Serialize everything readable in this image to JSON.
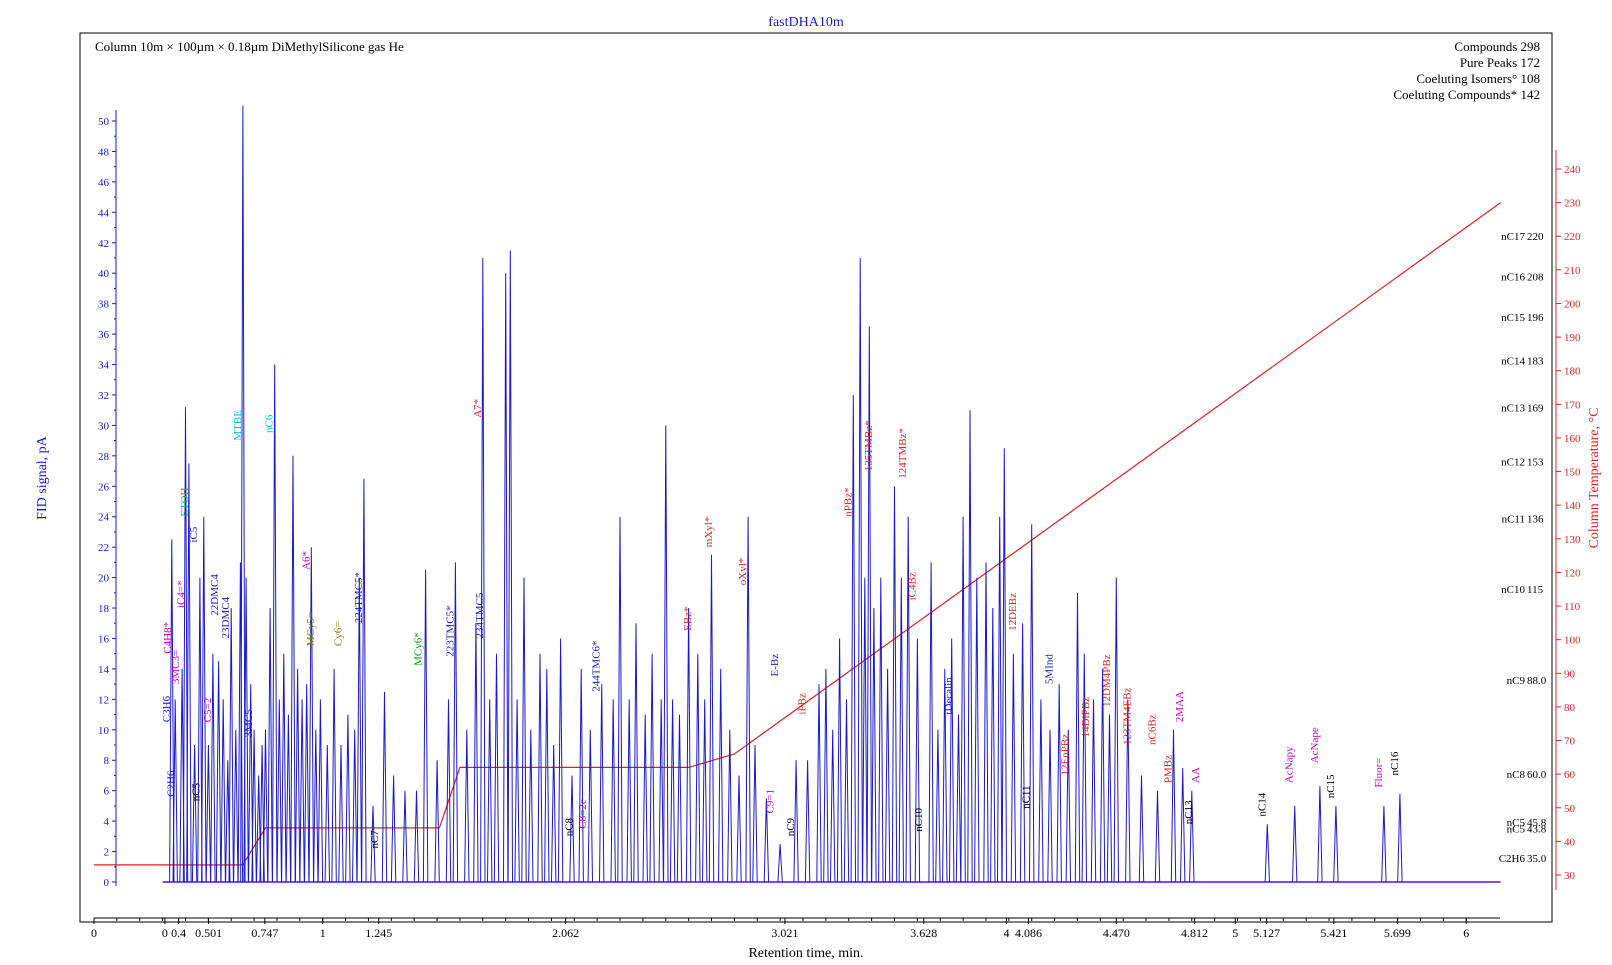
{
  "chart_data": {
    "type": "line",
    "title": "fastDHA10m",
    "subtitle": "Column 10m × 100µm × 0.18µm DiMethylSilicone gas He",
    "stats": [
      "Compounds 298",
      "Pure Peaks 172",
      "Coeluting Isomers° 108",
      "Coeluting Compounds* 142"
    ],
    "xlabel": "Retention time, min.",
    "ylabel": "FID signal, pA",
    "y2label": "Column Temperature, °C",
    "xlim": [
      0,
      6.2
    ],
    "ylim": [
      -1,
      52
    ],
    "y2lim": [
      23.5,
      246
    ],
    "x_ticks": [
      {
        "v": 0,
        "label": "0"
      },
      {
        "v": 0.31,
        "label": "0"
      },
      {
        "v": 0.37,
        "label": "0.4"
      },
      {
        "v": 0.501,
        "label": "0.501"
      },
      {
        "v": 0.747,
        "label": "0.747"
      },
      {
        "v": 1,
        "label": "1"
      },
      {
        "v": 1.245,
        "label": "1.245"
      },
      {
        "v": 2.062,
        "label": "2.062"
      },
      {
        "v": 3.021,
        "label": "3.021"
      },
      {
        "v": 3.628,
        "label": "3.628"
      },
      {
        "v": 3.99,
        "label": "4"
      },
      {
        "v": 4.086,
        "label": "4.086"
      },
      {
        "v": 4.47,
        "label": "4.470"
      },
      {
        "v": 4.812,
        "label": "4.812"
      },
      {
        "v": 4.99,
        "label": "5"
      },
      {
        "v": 5.127,
        "label": "5.127"
      },
      {
        "v": 5.421,
        "label": "5.421"
      },
      {
        "v": 5.699,
        "label": "5.699"
      },
      {
        "v": 6,
        "label": "6"
      }
    ],
    "y_ticks": [
      0,
      2,
      4,
      6,
      8,
      10,
      12,
      14,
      16,
      18,
      20,
      22,
      24,
      26,
      28,
      30,
      32,
      34,
      36,
      38,
      40,
      42,
      44,
      46,
      48,
      50
    ],
    "y2_ticks": [
      30,
      40,
      50,
      60,
      70,
      80,
      90,
      100,
      110,
      120,
      130,
      140,
      150,
      160,
      170,
      180,
      190,
      200,
      210,
      220,
      230,
      240
    ],
    "n_paraffin_markers": [
      {
        "label": "nC17",
        "value": "220",
        "t": 220
      },
      {
        "label": "nC16",
        "value": "208",
        "t": 208
      },
      {
        "label": "nC15",
        "value": "196",
        "t": 196
      },
      {
        "label": "nC14",
        "value": "183",
        "t": 183
      },
      {
        "label": "nC13",
        "value": "169",
        "t": 169
      },
      {
        "label": "nC12",
        "value": "153",
        "t": 153
      },
      {
        "label": "nC11",
        "value": "136",
        "t": 136
      },
      {
        "label": "nC10",
        "value": "115",
        "t": 115
      },
      {
        "label": "nC9",
        "value": "88.0",
        "t": 88
      },
      {
        "label": "nC8",
        "value": "60.0",
        "t": 60
      },
      {
        "label": "nC5",
        "value": "45.8",
        "t": 45.8
      },
      {
        "label": "nC5",
        "value": "43.8",
        "t": 43.8
      },
      {
        "label": "C2H6",
        "value": "35.0",
        "t": 35
      }
    ],
    "temperature_program": [
      [
        0,
        33
      ],
      [
        0.65,
        33
      ],
      [
        0.75,
        44
      ],
      [
        1.51,
        44
      ],
      [
        1.6,
        62
      ],
      [
        2.6,
        62
      ],
      [
        2.8,
        66
      ],
      [
        6.15,
        230
      ]
    ],
    "peaks": [
      {
        "x": 0.34,
        "h": 22.5
      },
      {
        "x": 0.355,
        "h": 12
      },
      {
        "x": 0.385,
        "h": 14
      },
      {
        "x": 0.4,
        "h": 31.2
      },
      {
        "x": 0.415,
        "h": 27.5
      },
      {
        "x": 0.44,
        "h": 9
      },
      {
        "x": 0.463,
        "h": 20
      },
      {
        "x": 0.48,
        "h": 24
      },
      {
        "x": 0.5,
        "h": 9
      },
      {
        "x": 0.52,
        "h": 15
      },
      {
        "x": 0.545,
        "h": 14.5
      },
      {
        "x": 0.565,
        "h": 12
      },
      {
        "x": 0.585,
        "h": 8
      },
      {
        "x": 0.6,
        "h": 18
      },
      {
        "x": 0.62,
        "h": 10
      },
      {
        "x": 0.64,
        "h": 21
      },
      {
        "x": 0.651,
        "h": 51
      },
      {
        "x": 0.665,
        "h": 20
      },
      {
        "x": 0.685,
        "h": 13
      },
      {
        "x": 0.7,
        "h": 10
      },
      {
        "x": 0.72,
        "h": 7
      },
      {
        "x": 0.735,
        "h": 9
      },
      {
        "x": 0.75,
        "h": 10
      },
      {
        "x": 0.77,
        "h": 18
      },
      {
        "x": 0.79,
        "h": 34
      },
      {
        "x": 0.81,
        "h": 12
      },
      {
        "x": 0.83,
        "h": 15
      },
      {
        "x": 0.85,
        "h": 11
      },
      {
        "x": 0.87,
        "h": 28
      },
      {
        "x": 0.89,
        "h": 14
      },
      {
        "x": 0.91,
        "h": 12
      },
      {
        "x": 0.93,
        "h": 13
      },
      {
        "x": 0.95,
        "h": 22
      },
      {
        "x": 0.97,
        "h": 10
      },
      {
        "x": 0.99,
        "h": 12
      },
      {
        "x": 1.02,
        "h": 9
      },
      {
        "x": 1.05,
        "h": 14
      },
      {
        "x": 1.08,
        "h": 9
      },
      {
        "x": 1.11,
        "h": 11
      },
      {
        "x": 1.14,
        "h": 10
      },
      {
        "x": 1.16,
        "h": 20
      },
      {
        "x": 1.18,
        "h": 26.5
      },
      {
        "x": 1.22,
        "h": 5
      },
      {
        "x": 1.27,
        "h": 12.5
      },
      {
        "x": 1.31,
        "h": 7
      },
      {
        "x": 1.36,
        "h": 6
      },
      {
        "x": 1.41,
        "h": 6
      },
      {
        "x": 1.45,
        "h": 20.5
      },
      {
        "x": 1.5,
        "h": 8
      },
      {
        "x": 1.55,
        "h": 12
      },
      {
        "x": 1.58,
        "h": 21
      },
      {
        "x": 1.63,
        "h": 10
      },
      {
        "x": 1.67,
        "h": 17
      },
      {
        "x": 1.7,
        "h": 41
      },
      {
        "x": 1.73,
        "h": 12
      },
      {
        "x": 1.76,
        "h": 15
      },
      {
        "x": 1.8,
        "h": 40
      },
      {
        "x": 1.82,
        "h": 41.5
      },
      {
        "x": 1.85,
        "h": 12
      },
      {
        "x": 1.88,
        "h": 20
      },
      {
        "x": 1.91,
        "h": 10
      },
      {
        "x": 1.95,
        "h": 15
      },
      {
        "x": 1.98,
        "h": 14
      },
      {
        "x": 2.01,
        "h": 9
      },
      {
        "x": 2.04,
        "h": 16
      },
      {
        "x": 2.09,
        "h": 7
      },
      {
        "x": 2.13,
        "h": 14
      },
      {
        "x": 2.17,
        "h": 10
      },
      {
        "x": 2.22,
        "h": 13
      },
      {
        "x": 2.27,
        "h": 12
      },
      {
        "x": 2.3,
        "h": 24
      },
      {
        "x": 2.34,
        "h": 12
      },
      {
        "x": 2.37,
        "h": 17
      },
      {
        "x": 2.41,
        "h": 11
      },
      {
        "x": 2.44,
        "h": 15
      },
      {
        "x": 2.48,
        "h": 12
      },
      {
        "x": 2.5,
        "h": 30
      },
      {
        "x": 2.53,
        "h": 12
      },
      {
        "x": 2.56,
        "h": 11
      },
      {
        "x": 2.6,
        "h": 18
      },
      {
        "x": 2.64,
        "h": 15
      },
      {
        "x": 2.67,
        "h": 12
      },
      {
        "x": 2.7,
        "h": 21.5
      },
      {
        "x": 2.74,
        "h": 14
      },
      {
        "x": 2.78,
        "h": 10
      },
      {
        "x": 2.82,
        "h": 7
      },
      {
        "x": 2.86,
        "h": 24
      },
      {
        "x": 2.89,
        "h": 9
      },
      {
        "x": 2.94,
        "h": 5.5
      },
      {
        "x": 3.0,
        "h": 2.5
      },
      {
        "x": 3.07,
        "h": 8
      },
      {
        "x": 3.12,
        "h": 8
      },
      {
        "x": 3.17,
        "h": 13
      },
      {
        "x": 3.2,
        "h": 14
      },
      {
        "x": 3.23,
        "h": 10
      },
      {
        "x": 3.26,
        "h": 16
      },
      {
        "x": 3.29,
        "h": 12
      },
      {
        "x": 3.32,
        "h": 32
      },
      {
        "x": 3.35,
        "h": 41
      },
      {
        "x": 3.37,
        "h": 20
      },
      {
        "x": 3.39,
        "h": 36.5
      },
      {
        "x": 3.41,
        "h": 18
      },
      {
        "x": 3.44,
        "h": 20
      },
      {
        "x": 3.47,
        "h": 14
      },
      {
        "x": 3.5,
        "h": 26
      },
      {
        "x": 3.53,
        "h": 20
      },
      {
        "x": 3.56,
        "h": 24
      },
      {
        "x": 3.6,
        "h": 16
      },
      {
        "x": 3.66,
        "h": 21
      },
      {
        "x": 3.69,
        "h": 10
      },
      {
        "x": 3.72,
        "h": 14
      },
      {
        "x": 3.75,
        "h": 16
      },
      {
        "x": 3.78,
        "h": 11
      },
      {
        "x": 3.8,
        "h": 24
      },
      {
        "x": 3.83,
        "h": 31
      },
      {
        "x": 3.86,
        "h": 20
      },
      {
        "x": 3.9,
        "h": 21
      },
      {
        "x": 3.93,
        "h": 18
      },
      {
        "x": 3.96,
        "h": 24
      },
      {
        "x": 3.98,
        "h": 28.5
      },
      {
        "x": 4.02,
        "h": 15
      },
      {
        "x": 4.06,
        "h": 17
      },
      {
        "x": 4.1,
        "h": 23.5
      },
      {
        "x": 4.14,
        "h": 12
      },
      {
        "x": 4.18,
        "h": 10
      },
      {
        "x": 4.22,
        "h": 13
      },
      {
        "x": 4.26,
        "h": 10
      },
      {
        "x": 4.3,
        "h": 19
      },
      {
        "x": 4.33,
        "h": 15
      },
      {
        "x": 4.37,
        "h": 12
      },
      {
        "x": 4.41,
        "h": 14
      },
      {
        "x": 4.44,
        "h": 11
      },
      {
        "x": 4.47,
        "h": 20
      },
      {
        "x": 4.52,
        "h": 12
      },
      {
        "x": 4.58,
        "h": 7
      },
      {
        "x": 4.65,
        "h": 6
      },
      {
        "x": 4.72,
        "h": 10
      },
      {
        "x": 4.76,
        "h": 7.5
      },
      {
        "x": 4.8,
        "h": 6
      },
      {
        "x": 5.13,
        "h": 3.8
      },
      {
        "x": 5.25,
        "h": 5
      },
      {
        "x": 5.36,
        "h": 6.3
      },
      {
        "x": 5.43,
        "h": 5
      },
      {
        "x": 5.64,
        "h": 5
      },
      {
        "x": 5.71,
        "h": 5.8
      }
    ],
    "peak_labels": [
      {
        "x": 0.34,
        "y": 10.5,
        "text": "C3H6",
        "color": "#1a1acc"
      },
      {
        "x": 0.36,
        "y": 5.6,
        "text": "C2H6",
        "color": "#1a1acc"
      },
      {
        "x": 0.345,
        "y": 15,
        "text": "C4H8*",
        "color": "#c000c0"
      },
      {
        "x": 0.38,
        "y": 13,
        "text": "3MC3=",
        "color": "#c000c0"
      },
      {
        "x": 0.405,
        "y": 18,
        "text": "iC4=*",
        "color": "#c000c0"
      },
      {
        "x": 0.42,
        "y": 24,
        "text": "ETOH",
        "color": "#00c050"
      },
      {
        "x": 0.46,
        "y": 22.3,
        "text": "iC5",
        "color": "#1a1acc"
      },
      {
        "x": 0.47,
        "y": 5.3,
        "text": "nC5",
        "color": "#000000"
      },
      {
        "x": 0.52,
        "y": 10.5,
        "text": "C5=2",
        "color": "#c000c0"
      },
      {
        "x": 0.55,
        "y": 17.5,
        "text": "22DMC4",
        "color": "#1a1acc"
      },
      {
        "x": 0.6,
        "y": 16,
        "text": "23DMC4",
        "color": "#1a1acc"
      },
      {
        "x": 0.651,
        "y": 29,
        "text": "MTBE",
        "color": "#00c0e0"
      },
      {
        "x": 0.7,
        "y": 9.5,
        "text": "3MC5",
        "color": "#1a1acc"
      },
      {
        "x": 0.79,
        "y": 29.5,
        "text": "nC6",
        "color": "#00c0e0"
      },
      {
        "x": 0.95,
        "y": 20.5,
        "text": "A6*",
        "color": "#c000c0"
      },
      {
        "x": 0.97,
        "y": 15.5,
        "text": "MCy5=",
        "color": "#808000"
      },
      {
        "x": 1.09,
        "y": 15.5,
        "text": "Cy6=",
        "color": "#808000"
      },
      {
        "x": 1.18,
        "y": 17,
        "text": "224TMC5*",
        "color": "#1a1acc"
      },
      {
        "x": 1.25,
        "y": 2.2,
        "text": "nC7",
        "color": "#000000"
      },
      {
        "x": 1.44,
        "y": 14.2,
        "text": "MCy6*",
        "color": "#00a000"
      },
      {
        "x": 1.58,
        "y": 14.8,
        "text": "223TMC5*",
        "color": "#1a1acc"
      },
      {
        "x": 1.71,
        "y": 16,
        "text": "234TMC5",
        "color": "#1a1acc"
      },
      {
        "x": 1.7,
        "y": 30.5,
        "text": "A7*",
        "color": "#e02020"
      },
      {
        "x": 2.1,
        "y": 3,
        "text": "nC8",
        "color": "#000000"
      },
      {
        "x": 2.16,
        "y": 3.5,
        "text": "C8=2c",
        "color": "#c000c0"
      },
      {
        "x": 2.22,
        "y": 12.5,
        "text": "244TMC6*",
        "color": "#1a1acc"
      },
      {
        "x": 2.62,
        "y": 16.5,
        "text": "EBz*",
        "color": "#e02020"
      },
      {
        "x": 2.71,
        "y": 22,
        "text": "mXyl*",
        "color": "#e02020"
      },
      {
        "x": 2.86,
        "y": 19.5,
        "text": "oXyl*",
        "color": "#e02020"
      },
      {
        "x": 2.98,
        "y": 4.5,
        "text": "C9=1",
        "color": "#c000c0"
      },
      {
        "x": 3.07,
        "y": 3,
        "text": "nC9",
        "color": "#000000"
      },
      {
        "x": 3.0,
        "y": 13.5,
        "text": "E-Bz",
        "color": "#1a1acc"
      },
      {
        "x": 3.12,
        "y": 11,
        "text": "iPBz",
        "color": "#e02020"
      },
      {
        "x": 3.32,
        "y": 24,
        "text": "nPBz*",
        "color": "#e02020"
      },
      {
        "x": 3.41,
        "y": 27,
        "text": "135TMBz*",
        "color": "#e02020"
      },
      {
        "x": 3.56,
        "y": 26.5,
        "text": "124TMBz*",
        "color": "#e02020"
      },
      {
        "x": 3.6,
        "y": 18.5,
        "text": "iC4Bz",
        "color": "#e02020"
      },
      {
        "x": 3.63,
        "y": 3.3,
        "text": "nC10",
        "color": "#000000"
      },
      {
        "x": 3.76,
        "y": 11,
        "text": "tDecalin",
        "color": "#1a1acc"
      },
      {
        "x": 4.04,
        "y": 16.5,
        "text": "12DEBz",
        "color": "#e02020"
      },
      {
        "x": 4.1,
        "y": 4.8,
        "text": "nC11",
        "color": "#000000"
      },
      {
        "x": 4.2,
        "y": 13,
        "text": "5MInd",
        "color": "#1a1acc"
      },
      {
        "x": 4.27,
        "y": 7,
        "text": "12EnPBz",
        "color": "#e02020"
      },
      {
        "x": 4.36,
        "y": 9.5,
        "text": "14DiPBz",
        "color": "#e02020"
      },
      {
        "x": 4.45,
        "y": 11.5,
        "text": "12DM4PBz",
        "color": "#e02020"
      },
      {
        "x": 4.54,
        "y": 9,
        "text": "123TM4EBz",
        "color": "#e02020"
      },
      {
        "x": 4.65,
        "y": 9,
        "text": "nC6Bz",
        "color": "#e02020"
      },
      {
        "x": 4.72,
        "y": 6.5,
        "text": "PMBz",
        "color": "#e02020"
      },
      {
        "x": 4.77,
        "y": 10.5,
        "text": "2MAA",
        "color": "#c000c0"
      },
      {
        "x": 4.81,
        "y": 3.8,
        "text": "nC13",
        "color": "#000000"
      },
      {
        "x": 4.84,
        "y": 6.5,
        "text": "AA",
        "color": "#c000c0"
      },
      {
        "x": 5.13,
        "y": 4.3,
        "text": "nC14",
        "color": "#000000"
      },
      {
        "x": 5.25,
        "y": 6.5,
        "text": "AcNapy",
        "color": "#c000c0"
      },
      {
        "x": 5.36,
        "y": 7.8,
        "text": "AcNape",
        "color": "#c000c0"
      },
      {
        "x": 5.43,
        "y": 5.5,
        "text": "nC15",
        "color": "#000000"
      },
      {
        "x": 5.64,
        "y": 6.2,
        "text": "Fluor=",
        "color": "#c000c0"
      },
      {
        "x": 5.71,
        "y": 7,
        "text": "nC16",
        "color": "#000000"
      }
    ],
    "colors": {
      "signal": "#1a1acc",
      "temperature": "#e02020",
      "baseline": "#e000e0",
      "axis": "#000000"
    },
    "grid": false
  }
}
